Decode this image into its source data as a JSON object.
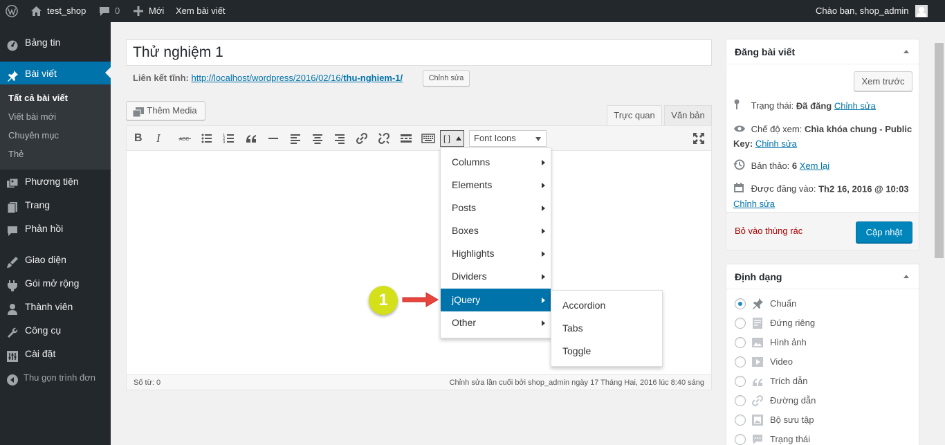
{
  "admin_bar": {
    "site_name": "test_shop",
    "comments_count": "0",
    "new_label": "Mới",
    "view_post_label": "Xem bài viết",
    "greeting": "Chào bạn, shop_admin"
  },
  "sidebar": {
    "items": [
      {
        "label": "Bảng tin",
        "icon": "dashboard-icon"
      },
      {
        "label": "Bài viết",
        "icon": "pin-icon"
      },
      {
        "label": "Phương tiện",
        "icon": "media-icon"
      },
      {
        "label": "Trang",
        "icon": "page-icon"
      },
      {
        "label": "Phản hồi",
        "icon": "comments-icon"
      },
      {
        "label": "Giao diện",
        "icon": "appearance-icon"
      },
      {
        "label": "Gói mở rộng",
        "icon": "plugins-icon"
      },
      {
        "label": "Thành viên",
        "icon": "users-icon"
      },
      {
        "label": "Công cụ",
        "icon": "tools-icon"
      },
      {
        "label": "Cài đặt",
        "icon": "settings-icon"
      }
    ],
    "submenu": [
      "Tất cả bài viết",
      "Viết bài mới",
      "Chuyên mục",
      "Thẻ"
    ],
    "collapse_label": "Thu gọn trình đơn"
  },
  "editor": {
    "title": "Thử nghiệm 1",
    "permalink_label": "Liên kết tĩnh:",
    "permalink_base": "http://localhost/wordpress/2016/02/16/",
    "permalink_slug": "thu-nghiem-1/",
    "edit_slug_label": "Chỉnh sửa",
    "add_media_label": "Thêm Media",
    "tab_visual": "Trực quan",
    "tab_text": "Văn bản",
    "shortcode_button": "[ ]",
    "font_icons_select": "Font Icons",
    "word_count": "Số từ: 0",
    "last_edited": "Chỉnh sửa lần cuối bởi shop_admin ngày 17 Tháng Hai, 2016 lúc 8:40 sáng"
  },
  "dropdown": {
    "items": [
      "Columns",
      "Elements",
      "Posts",
      "Boxes",
      "Highlights",
      "Dividers",
      "jQuery",
      "Other"
    ],
    "active": "jQuery",
    "submenu": [
      "Accordion",
      "Tabs",
      "Toggle"
    ]
  },
  "annotation": {
    "step_number": "1",
    "badge_color": "#d4e01a",
    "arrow_color": "#e8453c"
  },
  "publish_box": {
    "title": "Đăng bài viết",
    "preview_label": "Xem trước",
    "status_label": "Trạng thái:",
    "status_value": "Đã đăng",
    "visibility_label": "Chế độ xem:",
    "visibility_value": "Chìa khóa chung - Public Key:",
    "revisions_label": "Bản thảo:",
    "revisions_value": "6",
    "revisions_link": "Xem lại",
    "published_label": "Được đăng vào:",
    "published_value": "Th2 16, 2016 @ 10:03",
    "edit_link": "Chỉnh sửa",
    "trash_label": "Bỏ vào thùng rác",
    "update_label": "Cập nhật"
  },
  "format_box": {
    "title": "Định dạng",
    "options": [
      {
        "label": "Chuẩn",
        "icon": "pin-icon",
        "checked": true
      },
      {
        "label": "Đứng riêng",
        "icon": "aside-icon",
        "checked": false
      },
      {
        "label": "Hình ảnh",
        "icon": "image-icon",
        "checked": false
      },
      {
        "label": "Video",
        "icon": "video-icon",
        "checked": false
      },
      {
        "label": "Trích dẫn",
        "icon": "quote-icon",
        "checked": false
      },
      {
        "label": "Đường dẫn",
        "icon": "link-icon",
        "checked": false
      },
      {
        "label": "Bộ sưu tập",
        "icon": "gallery-icon",
        "checked": false
      },
      {
        "label": "Trạng thái",
        "icon": "status-icon",
        "checked": false
      }
    ]
  },
  "colors": {
    "admin_dark": "#23282d",
    "accent_blue": "#0073aa",
    "trash_red": "#a00"
  }
}
